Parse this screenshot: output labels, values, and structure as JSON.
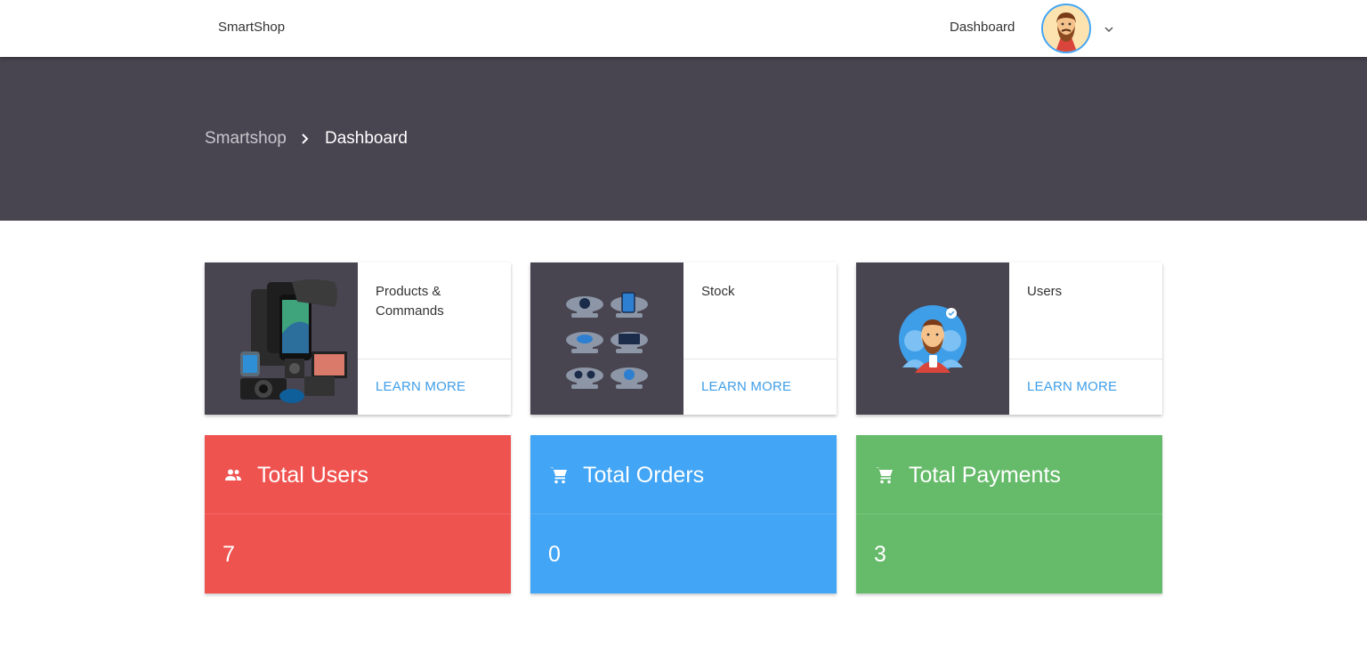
{
  "navbar": {
    "brand": "SmartShop",
    "dashboard_link": "Dashboard",
    "avatar_icon": "user-avatar-icon",
    "menu_icon": "chevron-down-icon"
  },
  "breadcrumb": {
    "root": "Smartshop",
    "separator_icon": "chevron-right-icon",
    "current": "Dashboard"
  },
  "cards": [
    {
      "title": "Products & Commands",
      "action": "LEARN MORE",
      "image": "products-illustration"
    },
    {
      "title": "Stock",
      "action": "LEARN MORE",
      "image": "stock-illustration"
    },
    {
      "title": "Users",
      "action": "LEARN MORE",
      "image": "users-illustration"
    }
  ],
  "stats": [
    {
      "title": "Total Users",
      "value": "7",
      "icon": "group-icon",
      "color": "#ef5350"
    },
    {
      "title": "Total Orders",
      "value": "0",
      "icon": "cart-icon",
      "color": "#42a5f5"
    },
    {
      "title": "Total Payments",
      "value": "3",
      "icon": "cart-icon",
      "color": "#66bb6a"
    }
  ],
  "colors": {
    "hero_background": "#484450",
    "link_accent": "#3f9ee8",
    "avatar_border": "#42a5f5"
  }
}
